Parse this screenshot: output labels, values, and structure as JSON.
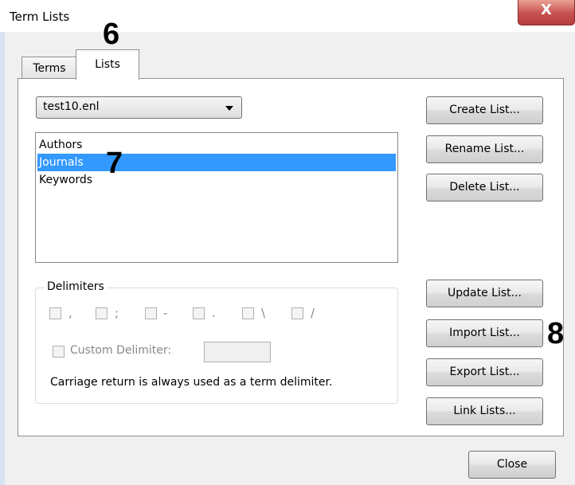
{
  "window": {
    "title": "Term Lists",
    "close_glyph": "X"
  },
  "callouts": {
    "tabs": "6",
    "list": "7",
    "import": "8"
  },
  "tabs": [
    {
      "label": "Terms",
      "active": false
    },
    {
      "label": "Lists",
      "active": true
    }
  ],
  "library_select": {
    "value": "test10.enl"
  },
  "lists": {
    "items": [
      "Authors",
      "Journals",
      "Keywords"
    ],
    "selected": "Journals"
  },
  "delimiters": {
    "label": "Delimiters",
    "options": [
      ",",
      ";",
      "-",
      ".",
      "\\",
      "/"
    ],
    "custom_label": "Custom Delimiter:",
    "custom_value": "",
    "note": "Carriage return is always used as a term delimiter."
  },
  "buttons": {
    "create": "Create List...",
    "rename": "Rename List...",
    "delete": "Delete List...",
    "update": "Update List...",
    "import": "Import List...",
    "export": "Export List...",
    "link": "Link Lists...",
    "close": "Close"
  },
  "colors": {
    "selection": "#3399ff",
    "close_button": "#c75050"
  }
}
